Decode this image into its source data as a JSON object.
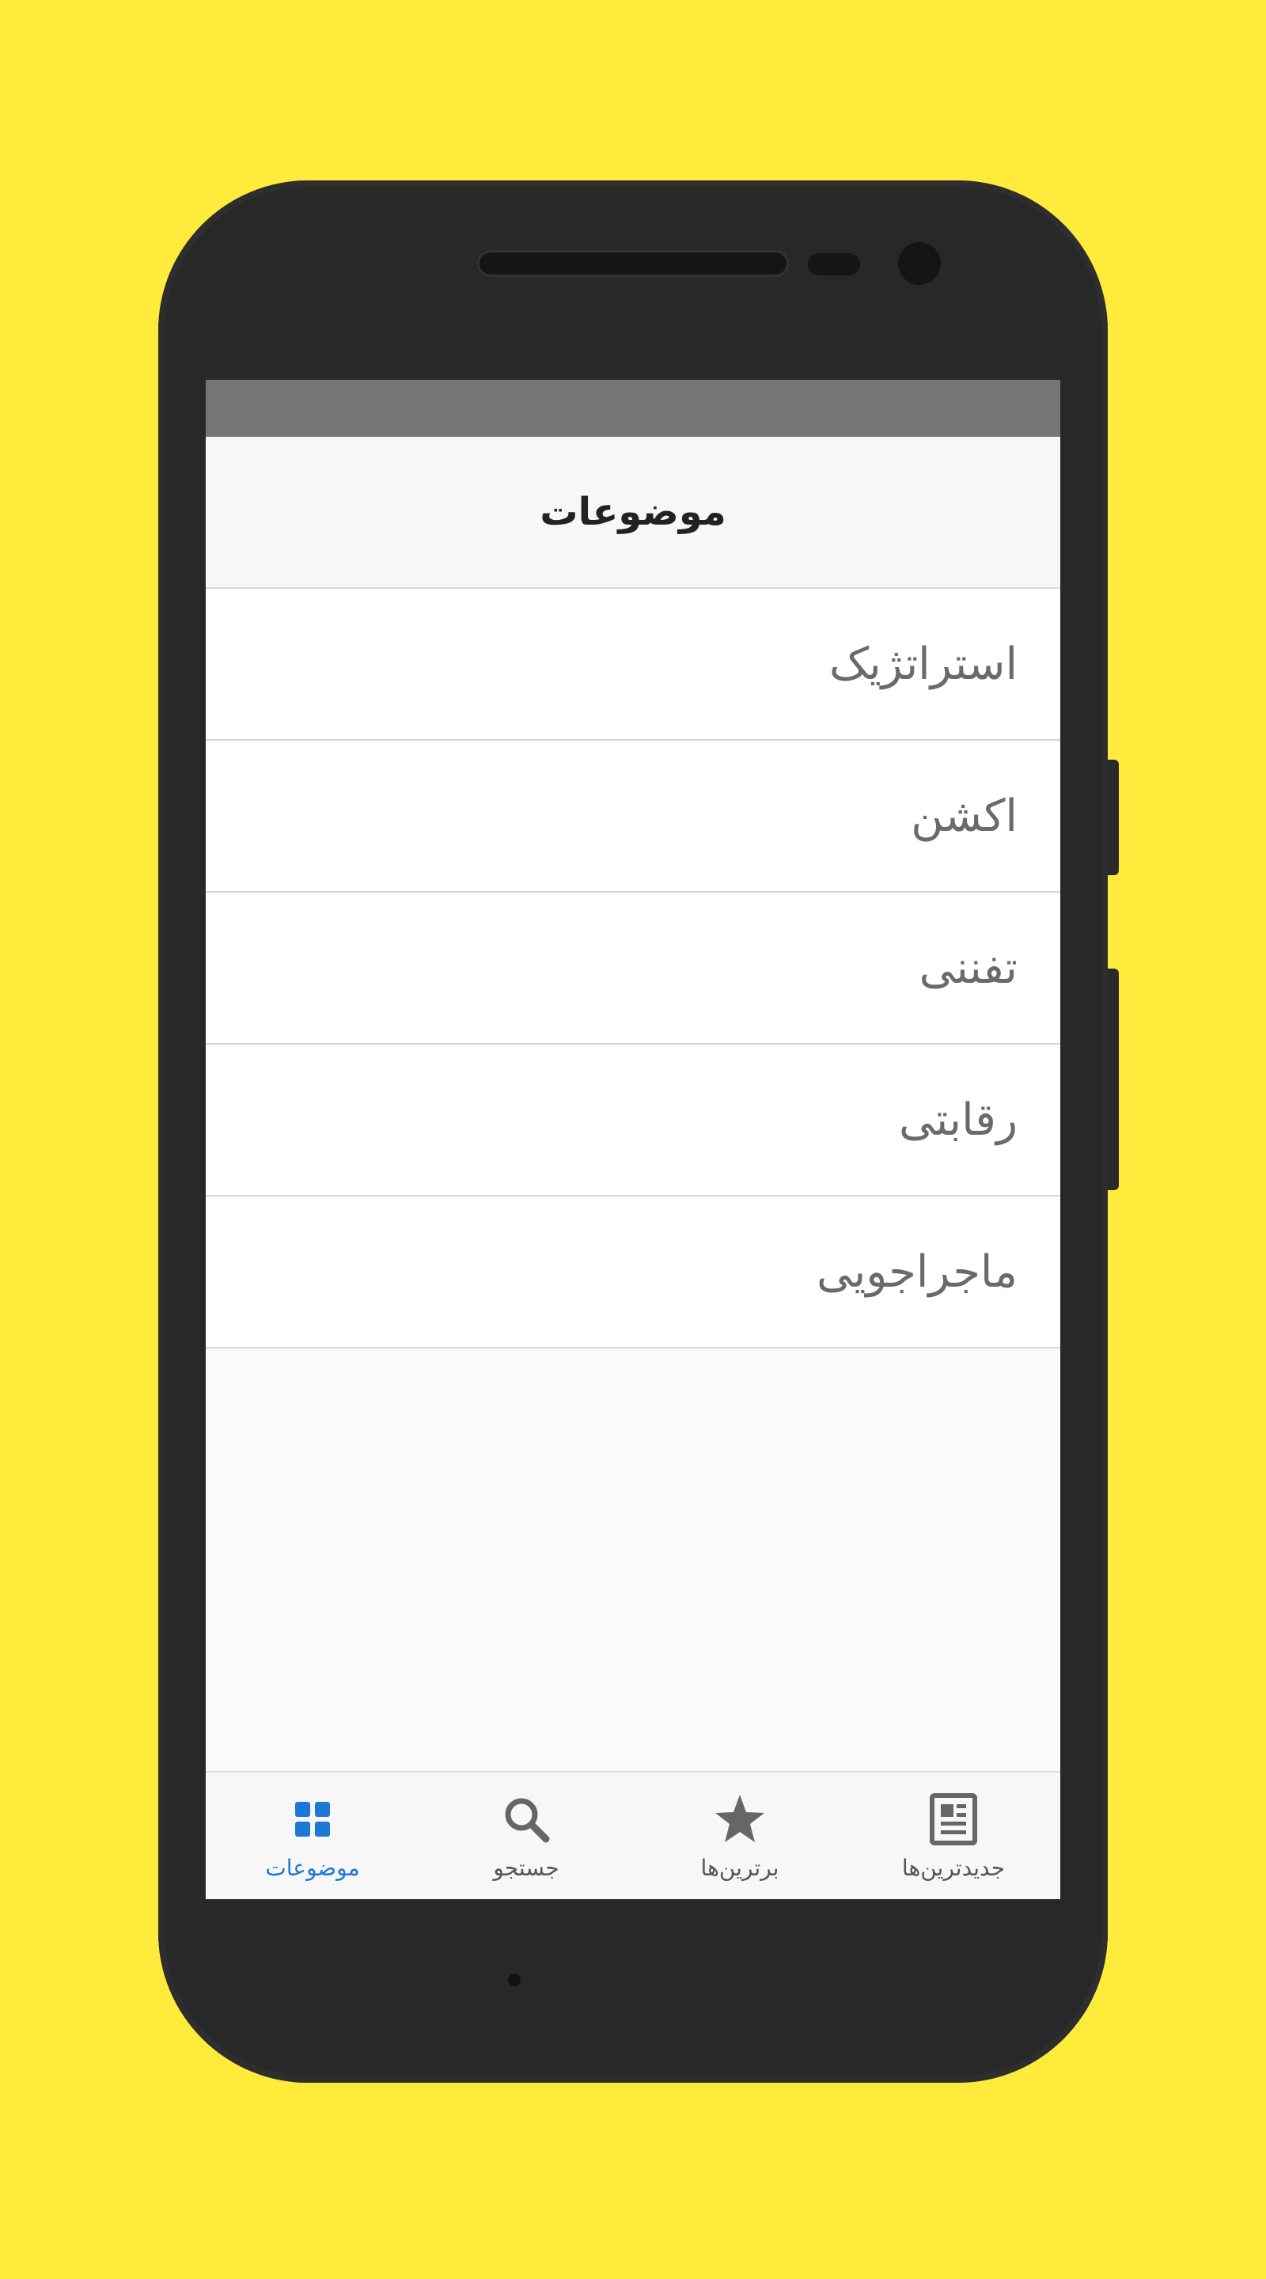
{
  "screen": {
    "title": "موضوعات",
    "categories": [
      {
        "label": "استراتژیک"
      },
      {
        "label": "اکشن"
      },
      {
        "label": "تفننی"
      },
      {
        "label": "رقابتی"
      },
      {
        "label": "ماجراجویی"
      }
    ],
    "bottom_nav": [
      {
        "label": "موضوعات",
        "icon": "grid-icon",
        "active": true
      },
      {
        "label": "جستجو",
        "icon": "search-icon",
        "active": false
      },
      {
        "label": "برترین‌ها",
        "icon": "star-icon",
        "active": false
      },
      {
        "label": "جدیدترین‌ها",
        "icon": "newspaper-icon",
        "active": false
      }
    ]
  },
  "colors": {
    "background": "#FFEB3B",
    "phone_body": "#282828",
    "status_bar": "#757575",
    "active_tab": "#1E78D7",
    "inactive_tab": "#555555"
  }
}
